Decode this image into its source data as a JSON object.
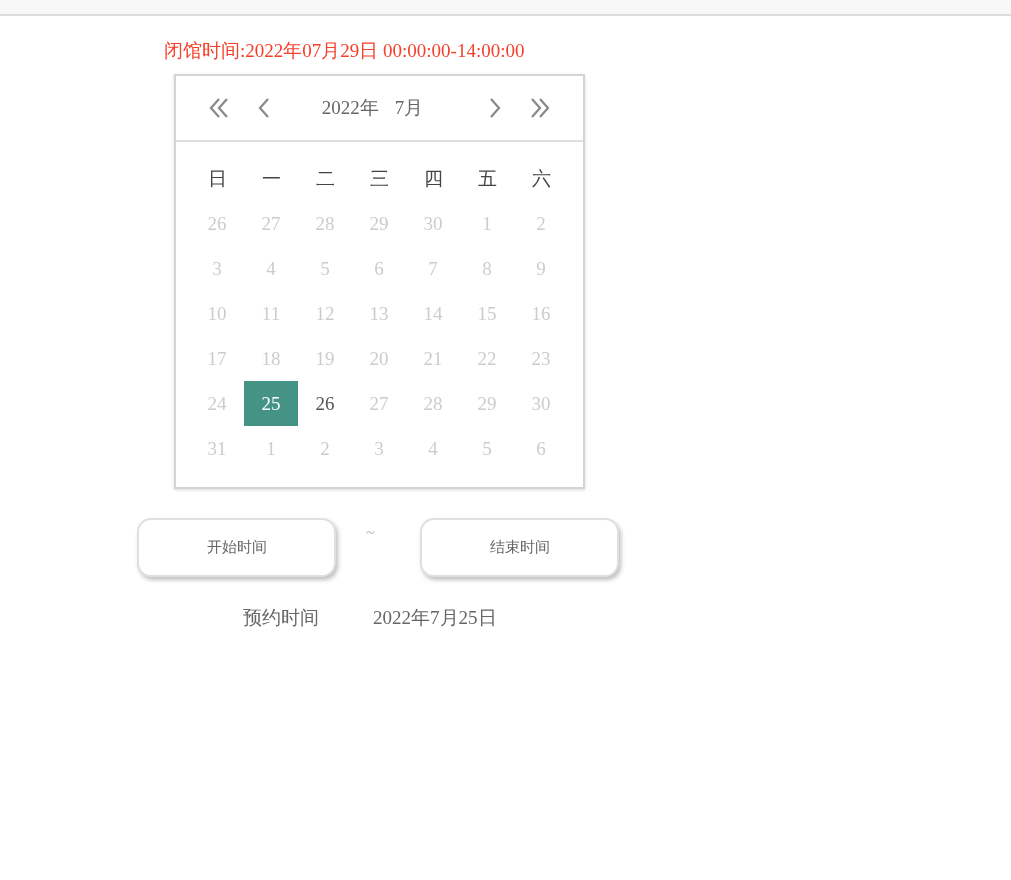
{
  "closing_notice": "闭馆时间:2022年07月29日 00:00:00-14:00:00",
  "calendar": {
    "year_label": "2022年",
    "month_label": "7月",
    "weekdays": [
      "日",
      "一",
      "二",
      "三",
      "四",
      "五",
      "六"
    ],
    "weeks": [
      [
        {
          "label": "26",
          "disabled": true,
          "selected": false
        },
        {
          "label": "27",
          "disabled": true,
          "selected": false
        },
        {
          "label": "28",
          "disabled": true,
          "selected": false
        },
        {
          "label": "29",
          "disabled": true,
          "selected": false
        },
        {
          "label": "30",
          "disabled": true,
          "selected": false
        },
        {
          "label": "1",
          "disabled": true,
          "selected": false
        },
        {
          "label": "2",
          "disabled": true,
          "selected": false
        }
      ],
      [
        {
          "label": "3",
          "disabled": true,
          "selected": false
        },
        {
          "label": "4",
          "disabled": true,
          "selected": false
        },
        {
          "label": "5",
          "disabled": true,
          "selected": false
        },
        {
          "label": "6",
          "disabled": true,
          "selected": false
        },
        {
          "label": "7",
          "disabled": true,
          "selected": false
        },
        {
          "label": "8",
          "disabled": true,
          "selected": false
        },
        {
          "label": "9",
          "disabled": true,
          "selected": false
        }
      ],
      [
        {
          "label": "10",
          "disabled": true,
          "selected": false
        },
        {
          "label": "11",
          "disabled": true,
          "selected": false
        },
        {
          "label": "12",
          "disabled": true,
          "selected": false
        },
        {
          "label": "13",
          "disabled": true,
          "selected": false
        },
        {
          "label": "14",
          "disabled": true,
          "selected": false
        },
        {
          "label": "15",
          "disabled": true,
          "selected": false
        },
        {
          "label": "16",
          "disabled": true,
          "selected": false
        }
      ],
      [
        {
          "label": "17",
          "disabled": true,
          "selected": false
        },
        {
          "label": "18",
          "disabled": true,
          "selected": false
        },
        {
          "label": "19",
          "disabled": true,
          "selected": false
        },
        {
          "label": "20",
          "disabled": true,
          "selected": false
        },
        {
          "label": "21",
          "disabled": true,
          "selected": false
        },
        {
          "label": "22",
          "disabled": true,
          "selected": false
        },
        {
          "label": "23",
          "disabled": true,
          "selected": false
        }
      ],
      [
        {
          "label": "24",
          "disabled": true,
          "selected": false
        },
        {
          "label": "25",
          "disabled": false,
          "selected": true
        },
        {
          "label": "26",
          "disabled": false,
          "selected": false
        },
        {
          "label": "27",
          "disabled": true,
          "selected": false
        },
        {
          "label": "28",
          "disabled": true,
          "selected": false
        },
        {
          "label": "29",
          "disabled": true,
          "selected": false
        },
        {
          "label": "30",
          "disabled": true,
          "selected": false
        }
      ],
      [
        {
          "label": "31",
          "disabled": true,
          "selected": false
        },
        {
          "label": "1",
          "disabled": true,
          "selected": false
        },
        {
          "label": "2",
          "disabled": true,
          "selected": false
        },
        {
          "label": "3",
          "disabled": true,
          "selected": false
        },
        {
          "label": "4",
          "disabled": true,
          "selected": false
        },
        {
          "label": "5",
          "disabled": true,
          "selected": false
        },
        {
          "label": "6",
          "disabled": true,
          "selected": false
        }
      ]
    ]
  },
  "time_range": {
    "start_button": "开始时间",
    "separator": "~",
    "end_button": "结束时间"
  },
  "booking": {
    "label": "预约时间",
    "value": "2022年7月25日"
  }
}
